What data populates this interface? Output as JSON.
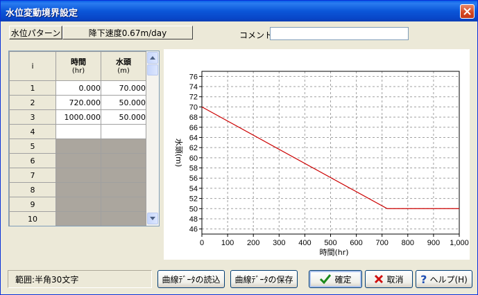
{
  "window": {
    "title": "水位変動境界設定",
    "close_icon": "close-icon"
  },
  "pattern": {
    "label": "水位パターン",
    "value": "降下速度0.67m/day"
  },
  "comment": {
    "label": "コメント",
    "value": ""
  },
  "grid": {
    "header_i": "i",
    "col_time": "時間",
    "col_time_unit": "(hr)",
    "col_head": "水頭",
    "col_head_unit": "(m)",
    "rows": [
      {
        "i": "1",
        "time": "0.000",
        "head": "70.000"
      },
      {
        "i": "2",
        "time": "720.000",
        "head": "50.000"
      },
      {
        "i": "3",
        "time": "1000.000",
        "head": "50.000"
      },
      {
        "i": "4",
        "time": "",
        "head": ""
      },
      {
        "i": "5",
        "time": "",
        "head": ""
      },
      {
        "i": "6",
        "time": "",
        "head": ""
      },
      {
        "i": "7",
        "time": "",
        "head": ""
      },
      {
        "i": "8",
        "time": "",
        "head": ""
      },
      {
        "i": "9",
        "time": "",
        "head": ""
      },
      {
        "i": "10",
        "time": "",
        "head": ""
      }
    ]
  },
  "chart_data": {
    "type": "line",
    "xlabel": "時間(hr)",
    "ylabel": "水頭(m)",
    "xlim": [
      0,
      1000
    ],
    "ylim": [
      45,
      77
    ],
    "x_ticks": [
      "0",
      "100",
      "200",
      "300",
      "400",
      "500",
      "600",
      "700",
      "800",
      "900",
      "1,000"
    ],
    "y_ticks": [
      "46",
      "48",
      "50",
      "52",
      "54",
      "56",
      "58",
      "60",
      "62",
      "64",
      "66",
      "68",
      "70",
      "72",
      "74",
      "76"
    ],
    "grid": true,
    "series": [
      {
        "x": [
          0,
          720,
          1000
        ],
        "y": [
          70,
          50,
          50
        ],
        "color": "#cc0000"
      }
    ]
  },
  "footer": {
    "status": "範囲:半角30文字",
    "load_button": "曲線ﾃﾞｰﾀの読込",
    "save_button": "曲線ﾃﾞｰﾀの保存",
    "ok_button": "確定",
    "cancel_button": "取消",
    "help_button": "ヘルプ(H)"
  }
}
